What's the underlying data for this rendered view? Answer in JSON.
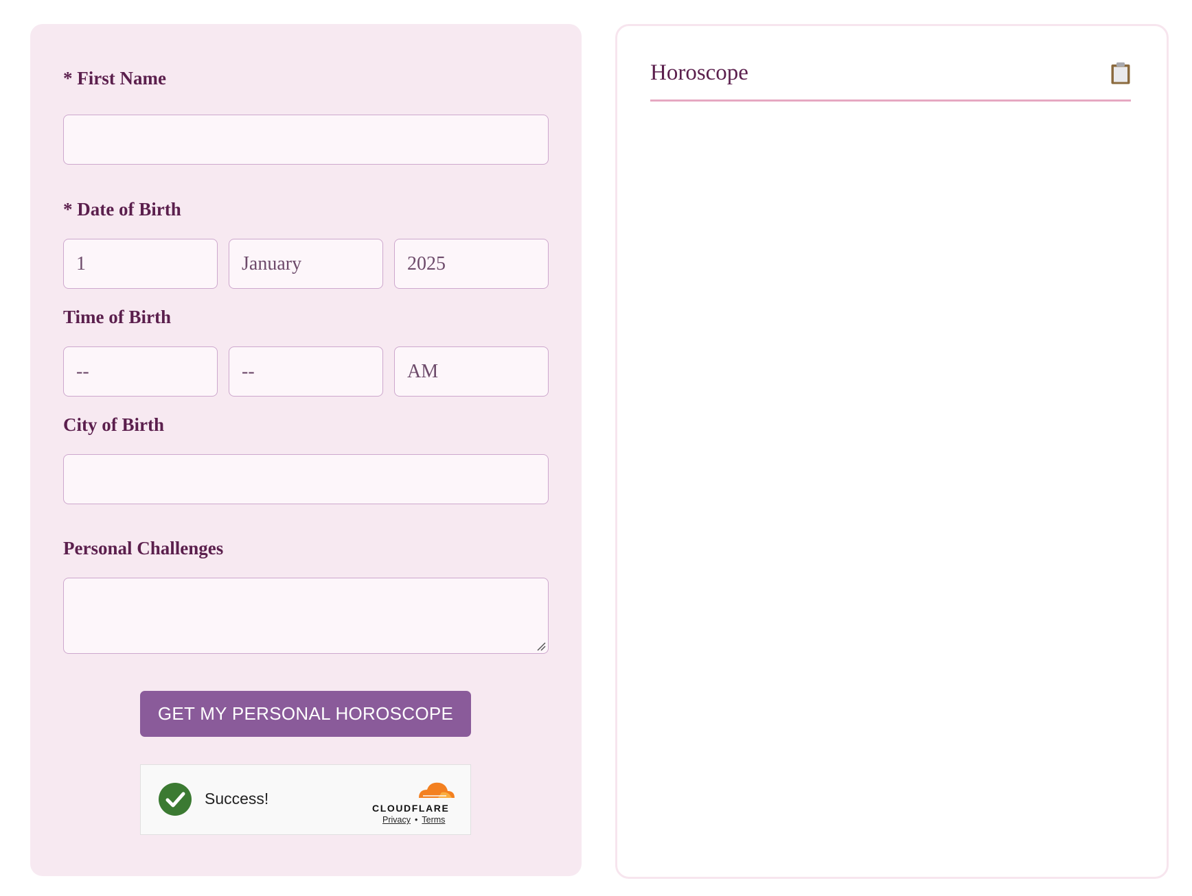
{
  "form": {
    "first_name": {
      "label": "* First Name",
      "value": ""
    },
    "date_of_birth": {
      "label": "* Date of Birth",
      "day": "1",
      "month": "January",
      "year": "2025"
    },
    "time_of_birth": {
      "label": "Time of Birth",
      "hour": "--",
      "minute": "--",
      "ampm": "AM"
    },
    "city_of_birth": {
      "label": "City of Birth",
      "value": ""
    },
    "personal_challenges": {
      "label": "Personal Challenges",
      "value": ""
    },
    "submit_label": "GET MY PERSONAL HOROSCOPE"
  },
  "captcha": {
    "status": "Success!",
    "brand": "CLOUDFLARE",
    "privacy": "Privacy",
    "separator": "•",
    "terms": "Terms",
    "check_color": "#3b7a32",
    "logo_color": "#f38020"
  },
  "result": {
    "title": "Horoscope",
    "copy_icon": "clipboard-icon"
  },
  "colors": {
    "accent": "#8a5b9a",
    "label": "#5b1f4d",
    "panel": "#f7e9f1",
    "underline": "#e6a8c1"
  }
}
